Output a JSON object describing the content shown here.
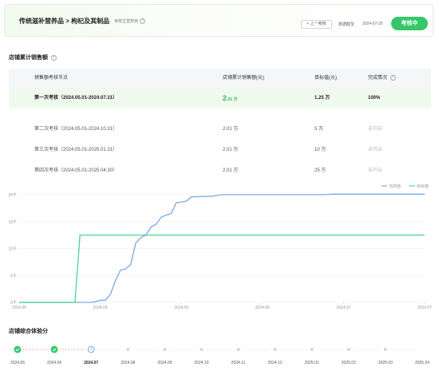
{
  "header": {
    "category": "传统滋补营养品 > 枸杞及其制品",
    "subtitle": "考核主营类目",
    "prev_button": "< 上一考核",
    "deadline_label": "数据截至",
    "deadline_date": "2024-07-20",
    "status": "考核中"
  },
  "sales_section": {
    "title": "店铺累计销售额",
    "columns": [
      "销售额考核节点",
      "店铺累计销售额(元)",
      "目标值(元)",
      "完成情况"
    ],
    "rows": [
      {
        "period": "第一次考核（2024.05.01-2024.07.31）",
        "sales_num": "2",
        "sales_rest": ".01 万",
        "target": "1.25 万",
        "status": "100%"
      },
      {
        "period": "第二次考核（2024.05.01-2024.10.31）",
        "sales": "2.01 万",
        "target": "5 万",
        "status": "未开启"
      },
      {
        "period": "第三次考核（2024.05.01-2025.01.31）",
        "sales": "2.01 万",
        "target": "10 万",
        "status": "未开启"
      },
      {
        "period": "第四次考核（2024.05.01-2025.04.30）",
        "sales": "2.01 万",
        "target": "25 万",
        "status": "未开启"
      }
    ]
  },
  "chart_data": {
    "type": "line",
    "legend": [
      "当前值",
      "目标值"
    ],
    "y_ticks": [
      "0千",
      "5千",
      "10千",
      "15千",
      "20千"
    ],
    "x_ticks": [
      "2024.05",
      "2024.05",
      "2024.06",
      "2024.06",
      "2024.07",
      "2024.07"
    ],
    "ylim": [
      0,
      20000
    ],
    "xlim": [
      0,
      80
    ],
    "current_color": "#7ba7e8",
    "target_color": "#48d39a",
    "series": [
      {
        "name": "当前值",
        "points": [
          [
            0,
            0
          ],
          [
            14,
            0
          ],
          [
            15,
            100
          ],
          [
            16,
            400
          ],
          [
            17,
            400
          ],
          [
            18,
            1500
          ],
          [
            19,
            4000
          ],
          [
            20,
            6000
          ],
          [
            21,
            6200
          ],
          [
            22,
            7000
          ],
          [
            23,
            11000
          ],
          [
            24,
            12000
          ],
          [
            25,
            12500
          ],
          [
            26,
            14000
          ],
          [
            27,
            14500
          ],
          [
            28,
            15800
          ],
          [
            29,
            16200
          ],
          [
            30,
            16500
          ],
          [
            31,
            18500
          ],
          [
            33,
            18800
          ],
          [
            34,
            19600
          ],
          [
            38,
            19700
          ],
          [
            40,
            20000
          ],
          [
            60,
            20000
          ],
          [
            62,
            20100
          ],
          [
            80,
            20100
          ]
        ]
      },
      {
        "name": "目标值",
        "points": [
          [
            0,
            0
          ],
          [
            11,
            0
          ],
          [
            12,
            12500
          ],
          [
            80,
            12500
          ]
        ]
      }
    ]
  },
  "score_section": {
    "title": "店铺综合体验分",
    "months": [
      "2024.05",
      "2024.06",
      "2024.07",
      "2024.08",
      "2024.09",
      "2024.10",
      "2024.11",
      "2024.12",
      "2025.01",
      "2025.02",
      "2025.03",
      "2025.04"
    ],
    "done_color": "#36c76b",
    "pending_dot_color": "#d6d6d6",
    "current_color": "#6a9be0"
  }
}
